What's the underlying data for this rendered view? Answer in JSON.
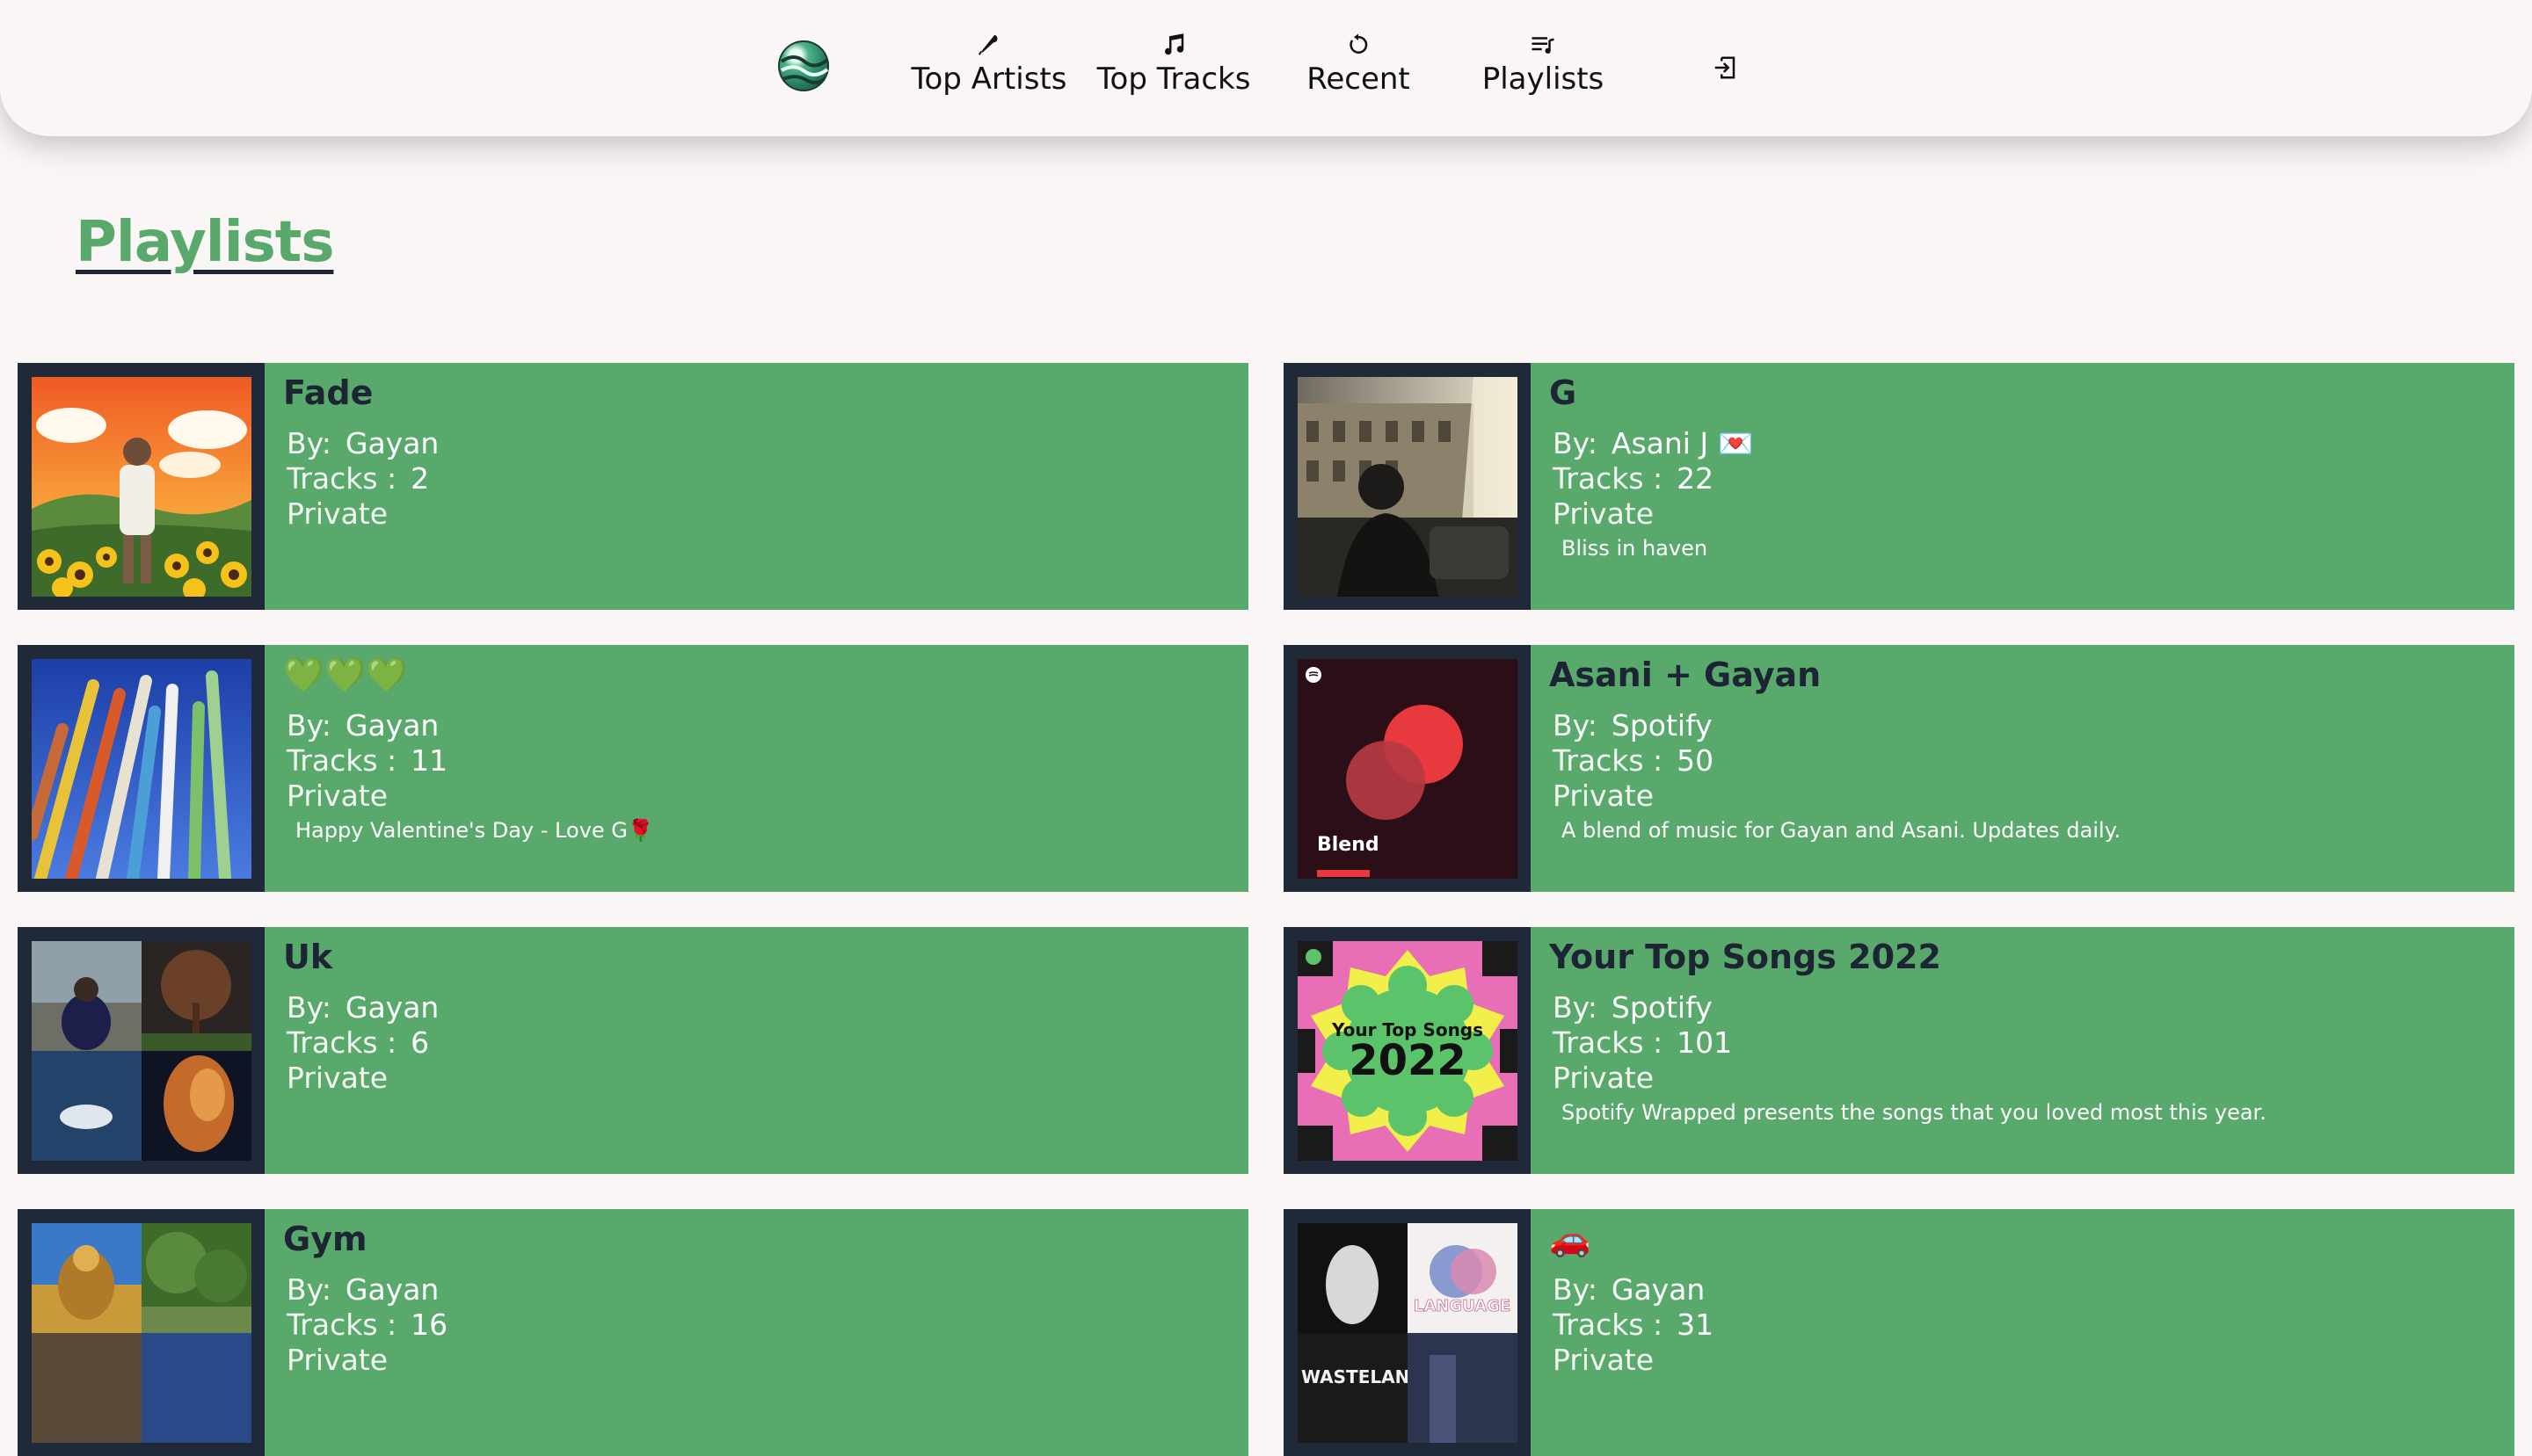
{
  "nav": {
    "items": [
      {
        "label": "Top Artists",
        "icon": "microphone-icon"
      },
      {
        "label": "Top Tracks",
        "icon": "music-note-icon"
      },
      {
        "label": "Recent",
        "icon": "history-icon"
      },
      {
        "label": "Playlists",
        "icon": "playlist-icon"
      }
    ],
    "logout_icon": "logout-icon",
    "logo_icon": "app-logo-icon"
  },
  "page": {
    "title": "Playlists"
  },
  "labels": {
    "by": "By:",
    "tracks": "Tracks :",
    "visibility": "Private"
  },
  "playlists": [
    {
      "name": "Fade",
      "by": "Gayan",
      "tracks": "2",
      "visibility": "Private",
      "description": ""
    },
    {
      "name": "G",
      "by": "Asani J 💌",
      "tracks": "22",
      "visibility": "Private",
      "description": "Bliss in haven"
    },
    {
      "name": "💚💚💚",
      "by": "Gayan",
      "tracks": "11",
      "visibility": "Private",
      "description": "Happy Valentine's Day - Love G🌹"
    },
    {
      "name": "Asani + Gayan",
      "by": "Spotify",
      "tracks": "50",
      "visibility": "Private",
      "description": "A blend of music for Gayan and Asani. Updates daily."
    },
    {
      "name": "Uk",
      "by": "Gayan",
      "tracks": "6",
      "visibility": "Private",
      "description": ""
    },
    {
      "name": "Your Top Songs 2022",
      "by": "Spotify",
      "tracks": "101",
      "visibility": "Private",
      "description": "Spotify Wrapped presents the songs that you loved most this year."
    },
    {
      "name": "Gym",
      "by": "Gayan",
      "tracks": "16",
      "visibility": "Private",
      "description": ""
    },
    {
      "name": "🚗",
      "by": "Gayan",
      "tracks": "31",
      "visibility": "Private",
      "description": ""
    }
  ],
  "cover_text": {
    "blend": "Blend",
    "wrapped_line1": "Your Top Songs",
    "wrapped_line2": "2022",
    "language": "LANGUAGE",
    "wasteland": "WASTELAND"
  },
  "colors": {
    "accent": "#58a96b",
    "card_dark": "#1f2937",
    "background": "#faf6f6"
  }
}
